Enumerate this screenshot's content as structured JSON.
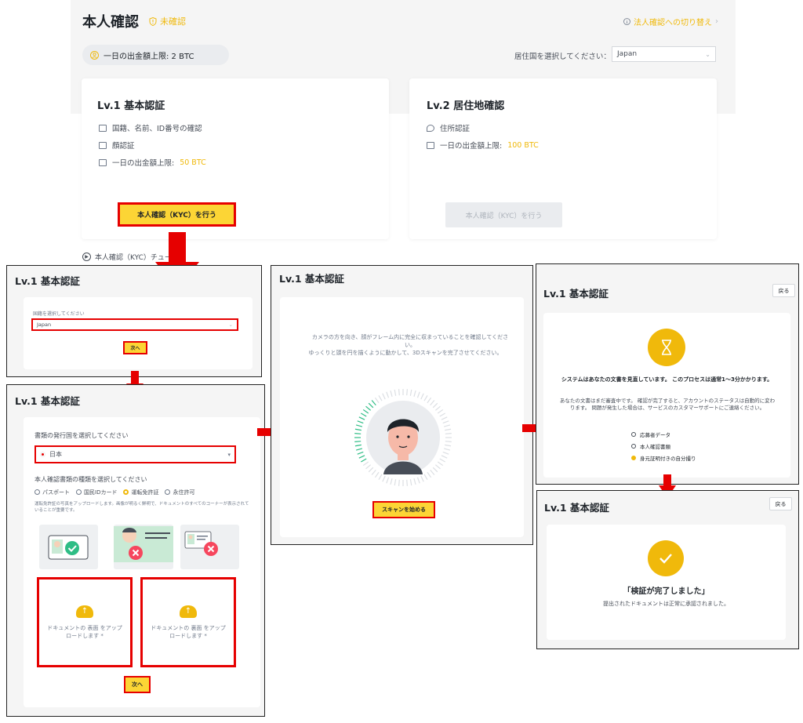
{
  "header": {
    "title": "本人確認",
    "status": "未確認",
    "corp_link": "法人確認への切り替え",
    "withdraw_limit": "一日の出金額上限: 2 BTC",
    "residence_label": "居住国を選択してください：",
    "residence_value": "Japan"
  },
  "cards": [
    {
      "title": "Lv.1 基本認証",
      "items": [
        "国籍、名前、ID番号の確認",
        "顔認証"
      ],
      "limit_label": "一日の出金額上限:",
      "limit_value": "50 BTC",
      "button": "本人確認（KYC）を行う"
    },
    {
      "title": "Lv.2 居住地確認",
      "items": [
        "住所認証"
      ],
      "limit_label": "一日の出金額上限:",
      "limit_value": "100 BTC",
      "button": "本人確認（KYC）を行う"
    }
  ],
  "tutorial": "本人確認（KYC）チュー",
  "panel_a": {
    "title": "Lv.1 基本認証",
    "label": "国籍を選択してください",
    "value": "Japan",
    "next": "次へ"
  },
  "panel_b": {
    "title": "Lv.1 基本認証",
    "issuer_label": "書類の発行国を選択してください",
    "issuer_value": "日本",
    "type_label": "本人確認書類の種類を選択してください",
    "types": [
      "パスポート",
      "国民IDカード",
      "運転免許証",
      "永住許可"
    ],
    "selected_type": "運転免許証",
    "note": "運転免許証の写真をアップロードします。画像が明るく鮮明で、ドキュメントのすべてのコーナーが表示されていることが重要です。",
    "upload_front": "ドキュメントの 表面 をアップロードします *",
    "upload_back": "ドキュメントの 裏面 をアップロードします *",
    "next": "次へ"
  },
  "panel_c": {
    "title": "Lv.1 基本認証",
    "instruction_1": "カメラの方を向き、顔がフレーム内に完全に収まっていることを確認してください。",
    "instruction_2": "ゆっくりと頭を円を描くように動かして、3Dスキャンを完了させてください。",
    "button": "スキャンを始める"
  },
  "panel_d": {
    "title": "Lv.1 基本認証",
    "back": "戻る",
    "heading": "システムはあなたの文書を見直しています。 このプロセスは通常1〜3分かかります。",
    "body": "あなたの文書はまだ審査中です。 確認が完了すると、アカウントのステータスは自動的に変わります。 問題が発生した場合は、サービスのカスタマーサポートにご連絡ください。",
    "checks": [
      "応募者データ",
      "本人確認書類",
      "身元証明付きの自分撮り"
    ]
  },
  "panel_e": {
    "title": "Lv.1 基本認証",
    "back": "戻る",
    "heading": "「検証が完了しました」",
    "sub": "提出されたドキュメントは正常に承認されました。"
  },
  "colors": {
    "accent": "#f0b90b",
    "highlight": "#e60000",
    "button": "#fcd535"
  }
}
